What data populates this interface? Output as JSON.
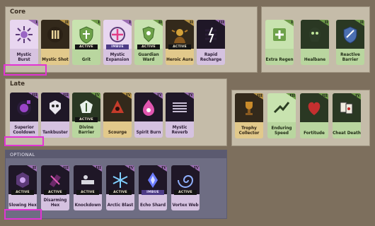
{
  "sections": {
    "core": {
      "title": "Core"
    },
    "late": {
      "title": "Late"
    },
    "optional": {
      "title": "OPTIONAL"
    }
  },
  "core_left": [
    {
      "name": "Mystic Burst",
      "tier": "I",
      "type": "spirit",
      "icon": "burst-icon"
    },
    {
      "name": "Mystic Shot",
      "tier": "II",
      "type": "weapon",
      "icon": "shot-icon"
    },
    {
      "name": "Grit",
      "tier": "I",
      "type": "vitality",
      "icon": "shield-icon",
      "badge": "ACTIVE"
    },
    {
      "name": "Mystic Expansion",
      "tier": "I",
      "type": "spirit",
      "icon": "expansion-icon",
      "badge": "IMBUE"
    },
    {
      "name": "Guardian Ward",
      "tier": "II",
      "type": "vitality",
      "icon": "ward-icon",
      "badge": "ACTIVE"
    },
    {
      "name": "Heroic Aura",
      "tier": "II",
      "type": "weapon",
      "icon": "aura-icon",
      "badge": "ACTIVE"
    },
    {
      "name": "Rapid Recharge",
      "tier": "III",
      "type": "spirit",
      "icon": "recharge-icon"
    }
  ],
  "core_right": [
    {
      "name": "Extra Regen",
      "tier": "I",
      "type": "vitality",
      "icon": "regen-icon"
    },
    {
      "name": "Healbane",
      "tier": "II",
      "type": "vitality",
      "icon": "healbane-icon"
    },
    {
      "name": "Reactive Barrier",
      "tier": "II",
      "type": "vitality",
      "icon": "barrier-icon"
    }
  ],
  "late_left": [
    {
      "name": "Superior Cooldown",
      "tier": "III",
      "type": "spirit",
      "icon": "cooldown-icon"
    },
    {
      "name": "Tankbuster",
      "tier": "III",
      "type": "spirit",
      "icon": "tankbuster-icon"
    },
    {
      "name": "Divine Barrier",
      "tier": "IV",
      "type": "vitality",
      "icon": "divine-barrier-icon",
      "badge": "ACTIVE"
    },
    {
      "name": "Scourge",
      "tier": "IV",
      "type": "weapon",
      "icon": "scourge-icon"
    },
    {
      "name": "Spirit Burn",
      "tier": "IV",
      "type": "spirit",
      "icon": "spirit-burn-icon"
    },
    {
      "name": "Mystic Reverb",
      "tier": "IV",
      "type": "spirit",
      "icon": "reverb-icon"
    }
  ],
  "late_right": [
    {
      "name": "Trophy Collector",
      "tier": "III",
      "type": "weapon",
      "icon": "trophy-icon"
    },
    {
      "name": "Enduring Speed",
      "tier": "III",
      "type": "vitality",
      "icon": "speed-icon"
    },
    {
      "name": "Fortitude",
      "tier": "III",
      "type": "vitality",
      "icon": "fortitude-icon"
    },
    {
      "name": "Cheat Death",
      "tier": "IV",
      "type": "vitality",
      "icon": "cheat-death-icon"
    }
  ],
  "optional_items": [
    {
      "name": "Slowing Hex",
      "tier": "II",
      "type": "spirit",
      "icon": "hex-icon",
      "badge": "ACTIVE"
    },
    {
      "name": "Disarming Hex",
      "tier": "III",
      "type": "spirit",
      "icon": "disarm-icon",
      "badge": "ACTIVE"
    },
    {
      "name": "Knockdown",
      "tier": "III",
      "type": "spirit",
      "icon": "knockdown-icon",
      "badge": "ACTIVE"
    },
    {
      "name": "Arctic Blast",
      "tier": "IV",
      "type": "spirit",
      "icon": "arctic-icon",
      "badge": "ACTIVE"
    },
    {
      "name": "Echo Shard",
      "tier": "IV",
      "type": "spirit",
      "icon": "echo-shard-icon",
      "badge": "IMBUE"
    },
    {
      "name": "Vortex Web",
      "tier": "IV",
      "type": "spirit",
      "icon": "vortex-icon",
      "badge": "ACTIVE"
    }
  ],
  "colors": {
    "weapon": "#e2c98b",
    "vitality": "#b9d69f",
    "spirit": "#d7c3e0",
    "highlight": "#e234d4"
  }
}
